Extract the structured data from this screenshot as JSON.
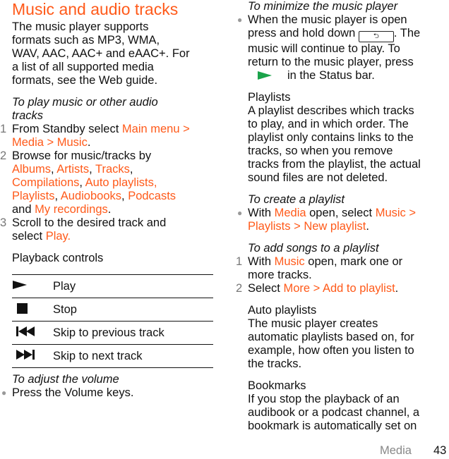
{
  "left": {
    "title": "Music and audio tracks",
    "intro": [
      "The music player supports",
      "formats such as MP3, WMA,",
      "WAV, AAC, AAC+ and eAAC+. For",
      "a list of all supported media",
      "formats, see the Web guide."
    ],
    "play_heading": [
      "To play music or other audio",
      "tracks"
    ],
    "steps": [
      {
        "n": "1",
        "t1": "From Standby select ",
        "o1": "Main menu >",
        "o2": "Media > Music",
        "end": "."
      },
      {
        "n": "2",
        "t1": "Browse for music/tracks by",
        "links": [
          "Albums",
          "Artists",
          "Tracks",
          "Compilations",
          "Auto playlists",
          "Playlists",
          "Audiobooks",
          "Podcasts",
          "My recordings"
        ],
        "and": "and "
      },
      {
        "n": "3",
        "t1": "Scroll to the desired track and",
        "t2": "select ",
        "o1": "Play."
      }
    ],
    "controls_heading": "Playback controls",
    "controls": [
      {
        "icon": "play-icon",
        "label": "Play"
      },
      {
        "icon": "stop-icon",
        "label": "Stop"
      },
      {
        "icon": "skip-previous-icon",
        "label": "Skip to previous track"
      },
      {
        "icon": "skip-next-icon",
        "label": "Skip to next track"
      }
    ],
    "volume_heading": "To adjust the volume",
    "volume_text": "Press the Volume keys."
  },
  "right": {
    "minimize_heading": "To minimize the music player",
    "minimize_lines": [
      "When the music player is open",
      "press and hold down",
      ". The",
      "music will continue to play. To",
      "return to the music player, press",
      "in the Status bar."
    ],
    "back_key_glyph": "⮌",
    "playlists_heading": "Playlists",
    "playlists_text": [
      "A playlist describes which tracks",
      "to play, and in which order. The",
      "playlist only contains links to the",
      "tracks, so when you remove",
      "tracks from the playlist, the actual",
      "sound files are not deleted."
    ],
    "create_heading": "To create a playlist",
    "create": {
      "t1": "With ",
      "o1": "Media",
      "t2": " open, select ",
      "o2": "Music >",
      "o3": "Playlists > New playlist",
      "end": "."
    },
    "add_heading": "To add songs to a playlist",
    "add_steps": [
      {
        "n": "1",
        "t1": "With ",
        "o1": "Music",
        "t2": " open, mark one or",
        "t3": "more tracks."
      },
      {
        "n": "2",
        "t1": "Select ",
        "o1": "More > Add to playlist",
        "end": "."
      }
    ],
    "auto_heading": "Auto playlists",
    "auto_text": [
      "The music player creates",
      "automatic playlists based on, for",
      "example, how often you listen to",
      "the tracks."
    ],
    "bookmarks_heading": "Bookmarks",
    "bookmarks_text": [
      "If you stop the playback of an",
      "audibook or a podcast channel, a",
      "bookmark is automatically set on"
    ]
  },
  "footer": {
    "section": "Media",
    "page": "43"
  },
  "colors": {
    "accent": "#ff5a1a",
    "status_play": "#1aa34a"
  }
}
